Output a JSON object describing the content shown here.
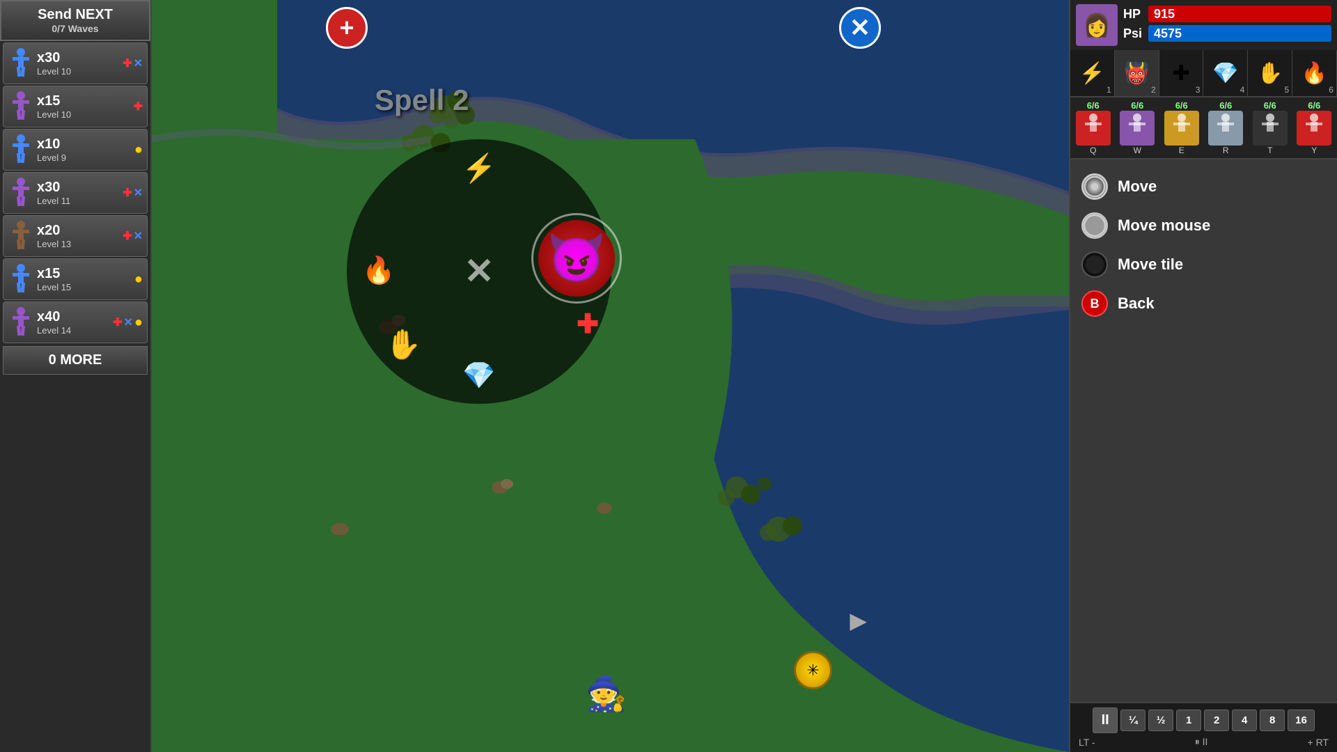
{
  "left_sidebar": {
    "send_next_label": "Send NEXT",
    "waves_label": "0/7 Waves",
    "units": [
      {
        "count": "x30",
        "level": "Level 10",
        "color": "blue",
        "badges": [
          "+",
          "x"
        ],
        "badge_colors": [
          "red",
          "blue"
        ]
      },
      {
        "count": "x15",
        "level": "Level 10",
        "color": "purple",
        "badges": [
          "+"
        ],
        "badge_colors": [
          "red"
        ]
      },
      {
        "count": "x10",
        "level": "Level 9",
        "color": "blue",
        "badges": [
          "●"
        ],
        "badge_colors": [
          "yellow"
        ]
      },
      {
        "count": "x30",
        "level": "Level 11",
        "color": "purple",
        "badges": [
          "+",
          "x"
        ],
        "badge_colors": [
          "red",
          "blue"
        ]
      },
      {
        "count": "x20",
        "level": "Level 13",
        "color": "brown",
        "badges": [
          "+",
          "x"
        ],
        "badge_colors": [
          "red",
          "blue"
        ]
      },
      {
        "count": "x15",
        "level": "Level 15",
        "color": "blue",
        "badges": [
          "●"
        ],
        "badge_colors": [
          "yellow"
        ]
      },
      {
        "count": "x40",
        "level": "Level 14",
        "color": "purple",
        "badges": [
          "+",
          "x",
          "●"
        ],
        "badge_colors": [
          "red",
          "blue",
          "yellow"
        ]
      }
    ],
    "more_label": "0 MORE"
  },
  "game": {
    "spell_label": "Spell 2",
    "top_plus_label": "+",
    "top_x_label": "✕"
  },
  "radial_menu": {
    "center_label": "✕",
    "spells": [
      {
        "name": "lightning",
        "symbol": "⚡",
        "position": "top"
      },
      {
        "name": "fireball",
        "symbol": "🔥",
        "position": "left"
      },
      {
        "name": "demon",
        "symbol": "👹",
        "position": "right",
        "highlighted": true
      },
      {
        "name": "hand",
        "symbol": "✋",
        "position": "bottom-left"
      },
      {
        "name": "crystal",
        "symbol": "💎",
        "position": "bottom"
      },
      {
        "name": "health",
        "symbol": "✚",
        "position": "bottom-right"
      }
    ]
  },
  "right_panel": {
    "avatar_symbol": "👩",
    "hp_label": "HP",
    "hp_value": "915",
    "psi_label": "Psi",
    "psi_value": "4575",
    "spell_slots": [
      {
        "symbol": "⚡",
        "key": "1",
        "color": "#ffcc00"
      },
      {
        "symbol": "👹",
        "key": "2",
        "color": "#cc2222"
      },
      {
        "symbol": "✚",
        "key": "3",
        "color": "#cc2222"
      },
      {
        "symbol": "💎",
        "key": "4",
        "color": "#4499ff"
      },
      {
        "symbol": "✋",
        "key": "5",
        "color": "#dddddd"
      },
      {
        "symbol": "🔥",
        "key": "6",
        "color": "#ff6600"
      }
    ],
    "char_slots": [
      {
        "count": "6/6",
        "symbol": "👤",
        "key": "Q",
        "color": "#cc2222"
      },
      {
        "count": "6/6",
        "symbol": "👤",
        "key": "W",
        "color": "#8855aa"
      },
      {
        "count": "6/6",
        "symbol": "👤",
        "key": "E",
        "color": "#cc9922"
      },
      {
        "count": "6/6",
        "symbol": "👤",
        "key": "R",
        "color": "#8899aa"
      },
      {
        "count": "6/6",
        "symbol": "👤",
        "key": "T",
        "color": "#333333"
      },
      {
        "count": "6/6",
        "symbol": "👤",
        "key": "Y",
        "color": "#cc2222"
      }
    ],
    "context_menu": {
      "items": [
        {
          "label": "Move",
          "icon_type": "white-ring"
        },
        {
          "label": "Move mouse",
          "icon_type": "white-circle"
        },
        {
          "label": "Move tile",
          "icon_type": "black-circle"
        },
        {
          "label": "Back",
          "icon_type": "b-button"
        }
      ]
    },
    "speed_buttons": [
      "II",
      "¼",
      "½",
      "1",
      "2",
      "4",
      "8",
      "16"
    ],
    "bottom_left_label": "LT  -",
    "bottom_right_label": "+  RT",
    "bottom_mid_label": "⏸ II"
  }
}
